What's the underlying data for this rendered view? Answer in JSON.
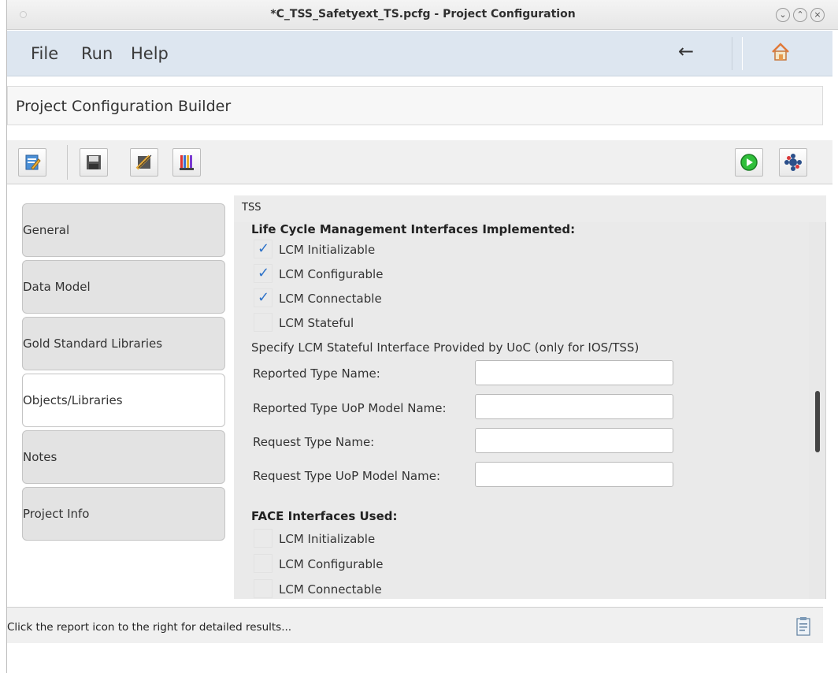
{
  "window": {
    "title": "*C_TSS_Safetyext_TS.pcfg - Project Configuration",
    "controls": [
      "minimize",
      "maximize",
      "close"
    ]
  },
  "menubar": {
    "items": [
      "File",
      "Run",
      "Help"
    ],
    "back_icon": "left-arrow-icon",
    "home_icon": "home-icon"
  },
  "header": {
    "title": "Project Configuration Builder"
  },
  "toolbar": {
    "left_icons": [
      "edit-project-icon",
      "save-icon",
      "validate-icon",
      "libraries-icon"
    ],
    "right_icons": [
      "run-icon",
      "settings-icon"
    ]
  },
  "nav": {
    "items": [
      {
        "label": "General",
        "active": false
      },
      {
        "label": "Data Model",
        "active": false
      },
      {
        "label": "Gold Standard Libraries",
        "active": false
      },
      {
        "label": "Objects/Libraries",
        "active": true
      },
      {
        "label": "Notes",
        "active": false
      },
      {
        "label": "Project Info",
        "active": false
      }
    ]
  },
  "panel": {
    "tab_label": "TSS",
    "lcm_section": {
      "title": "Life Cycle Management Interfaces Implemented:",
      "checkboxes": [
        {
          "label": "LCM Initializable",
          "checked": true
        },
        {
          "label": "LCM Configurable",
          "checked": true
        },
        {
          "label": "LCM Connectable",
          "checked": true
        },
        {
          "label": "LCM Stateful",
          "checked": false
        }
      ],
      "stateful_note": "Specify LCM Stateful Interface Provided by UoC (only for IOS/TSS)",
      "fields": [
        {
          "label": "Reported Type Name:",
          "value": ""
        },
        {
          "label": "Reported Type UoP Model Name:",
          "value": ""
        },
        {
          "label": "Request Type Name:",
          "value": ""
        },
        {
          "label": "Request Type UoP Model Name:",
          "value": ""
        }
      ]
    },
    "face_section": {
      "title": "FACE Interfaces Used:",
      "checkboxes": [
        {
          "label": "LCM Initializable",
          "checked": false
        },
        {
          "label": "LCM Configurable",
          "checked": false
        },
        {
          "label": "LCM Connectable",
          "checked": false
        }
      ]
    }
  },
  "status": {
    "message": "Click the report icon to the right for detailed results...",
    "report_icon": "report-icon"
  },
  "colors": {
    "menubar_bg": "#dde6f0",
    "check_blue": "#2f73c9",
    "run_green": "#2fbf3a"
  }
}
